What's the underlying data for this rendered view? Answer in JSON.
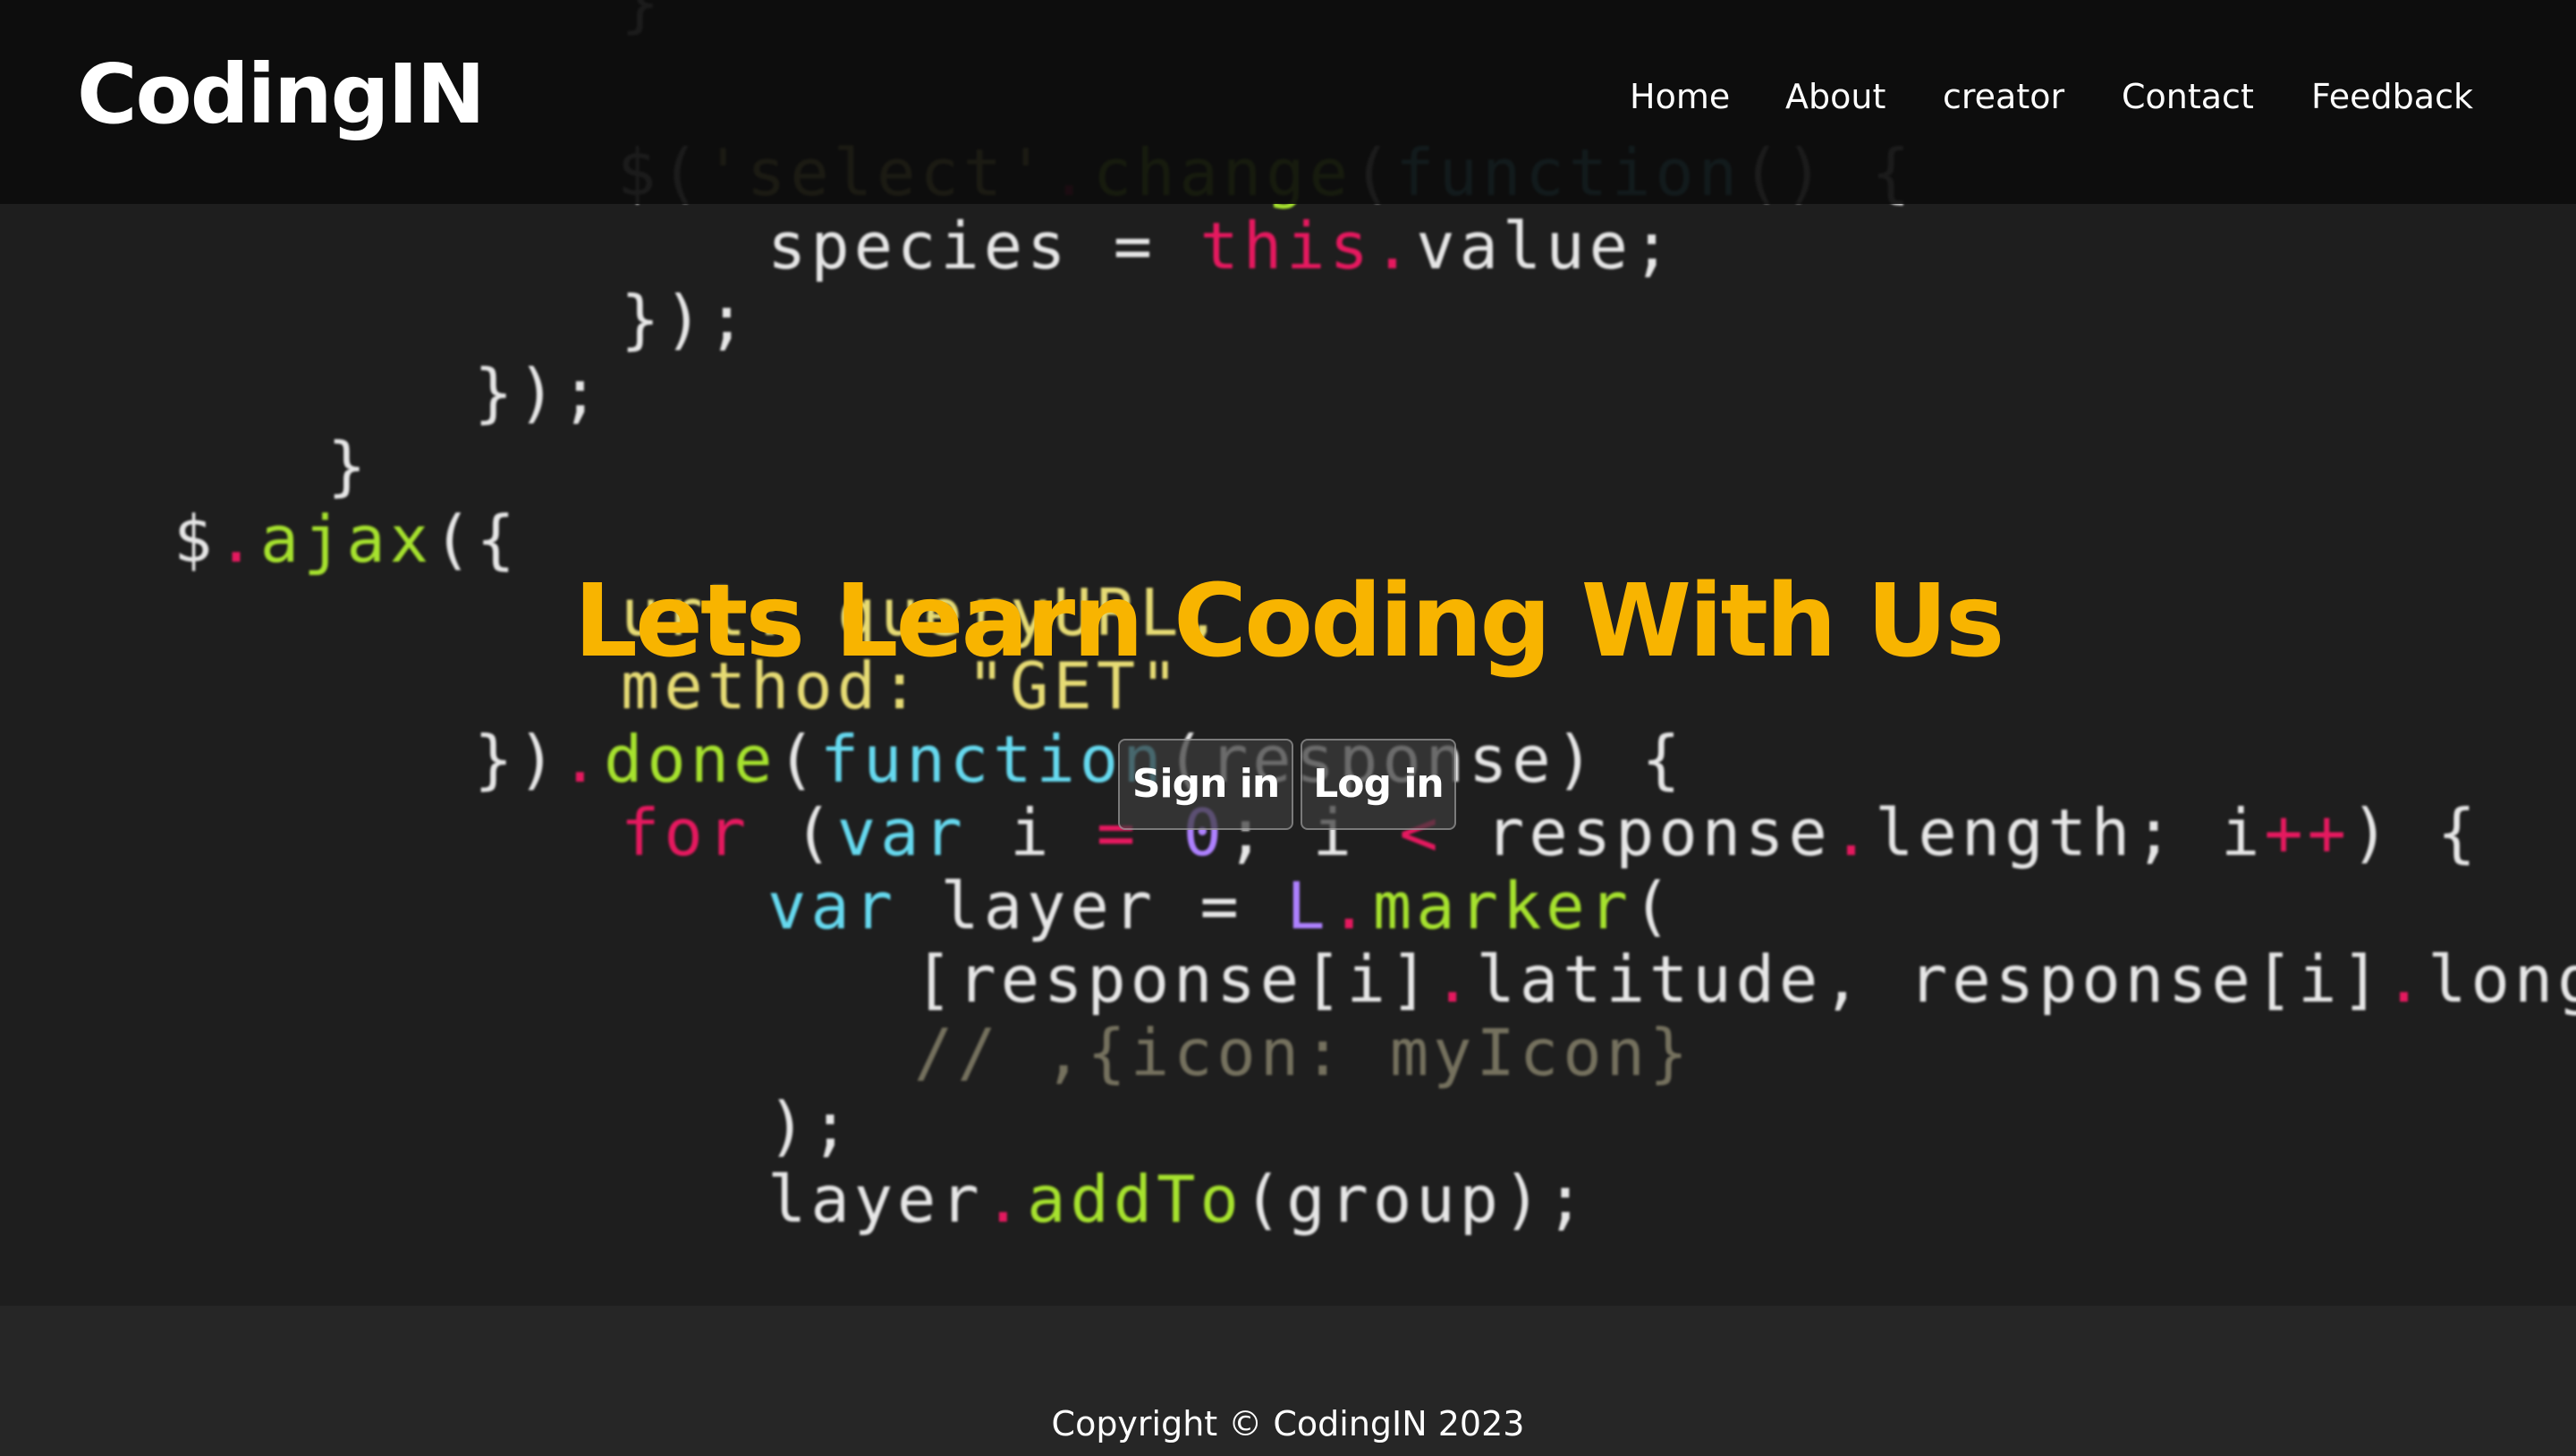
{
  "brand": "CodingIN",
  "nav": {
    "items": [
      "Home",
      "About",
      "creator",
      "Contact",
      "Feedback"
    ]
  },
  "hero": {
    "title": "Lets Learn Coding With Us",
    "buttons": {
      "signin": "Sign in",
      "login": "Log in"
    }
  },
  "footer": {
    "copyright": "Copyright © CodingIN 2023"
  },
  "background_code": {
    "lines": [
      "}",
      "$('select').change(function() {",
      "species = this.value;",
      "});",
      "});",
      "}",
      "$.ajax({",
      "url: queryURL,",
      "method: \"GET\"",
      "}).done(function(response) {",
      "for (var i = 0; i < response.length; i++) {",
      "var layer = L.marker(",
      "[response[i].latitude, response[i].longitude]",
      "// ,{icon: myIcon}",
      ");",
      "layer.addTo(group);"
    ]
  },
  "colors": {
    "accent": "#f8b400",
    "navbar_bg": "#0c0c0c",
    "hero_bg": "#1e1e1e",
    "footer_bg": "#262626",
    "text": "#ffffff"
  }
}
